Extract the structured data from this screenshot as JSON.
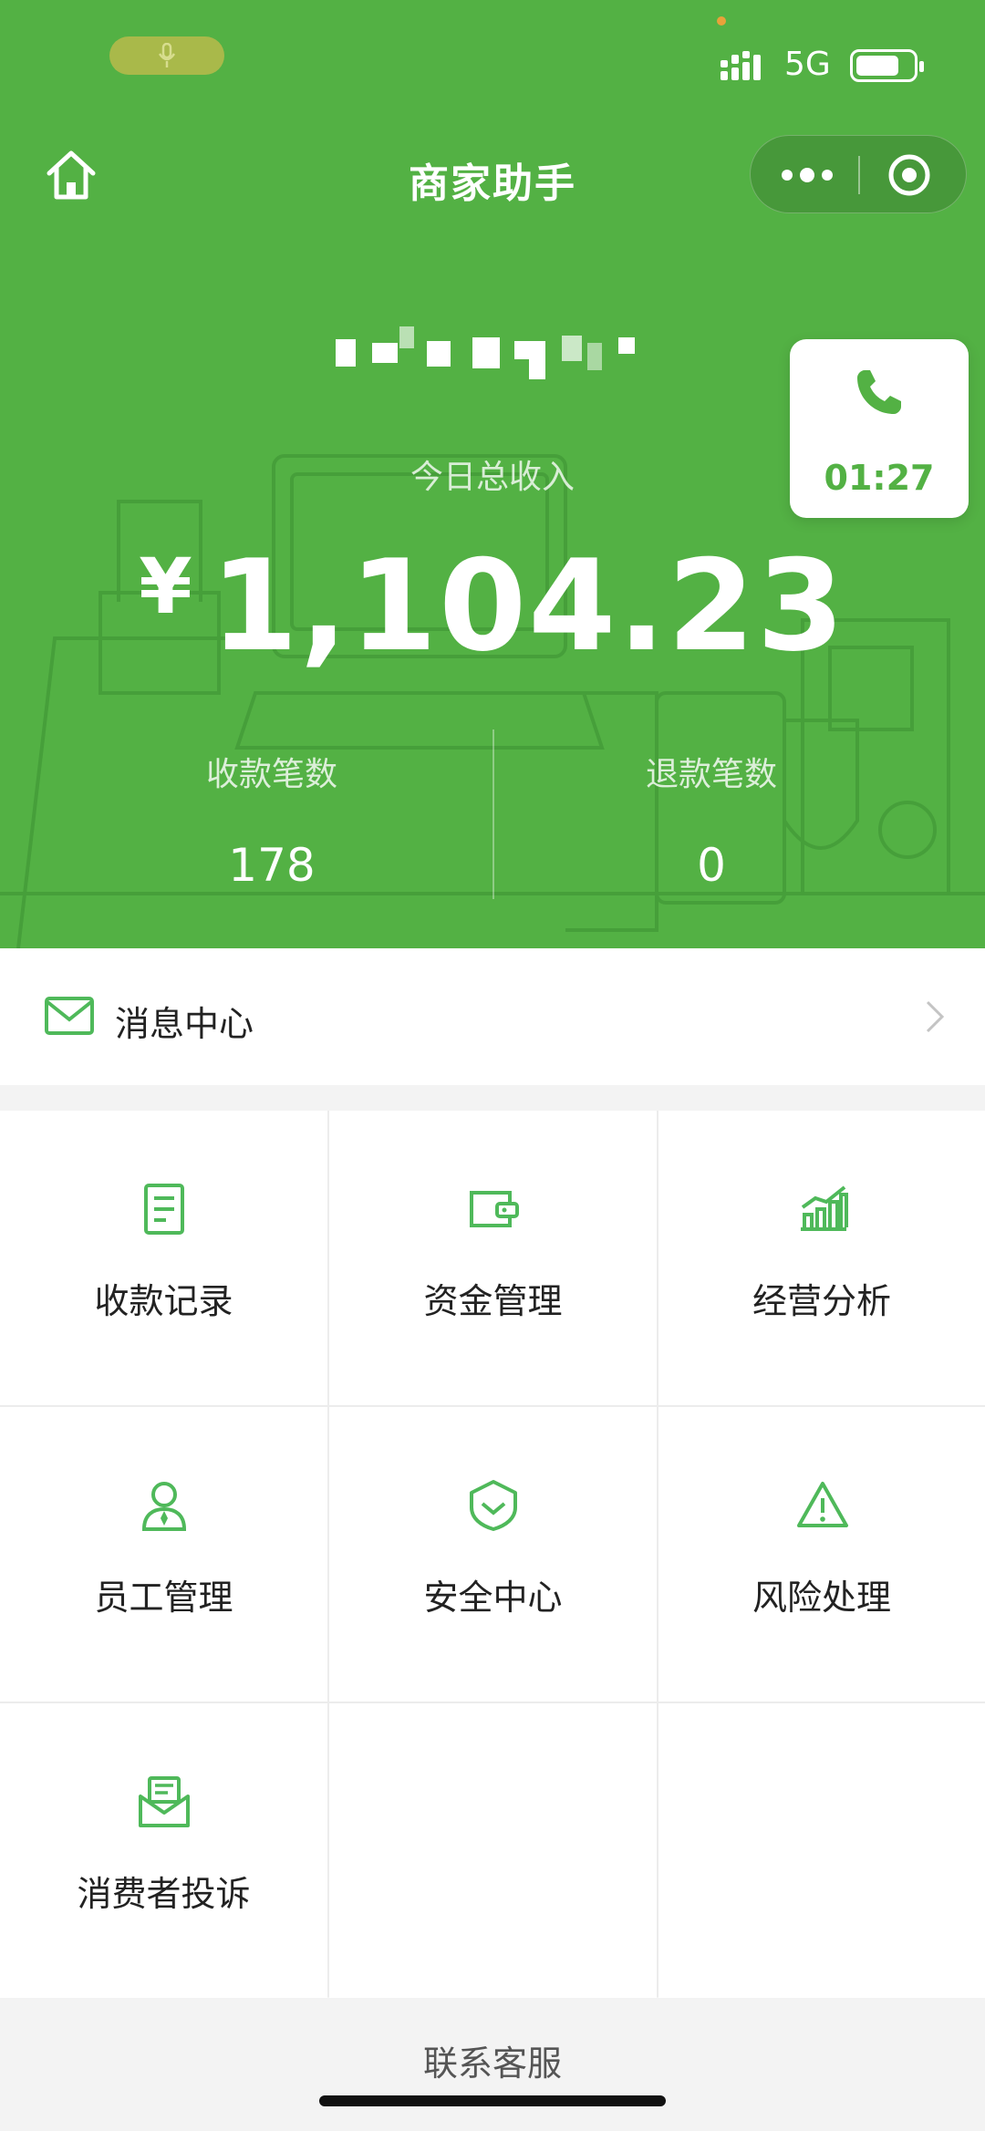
{
  "status_bar": {
    "network": "5G"
  },
  "nav": {
    "title": "商家助手"
  },
  "call": {
    "duration": "01:27"
  },
  "summary": {
    "income_label": "今日总收入",
    "currency": "¥",
    "income_amount": "1,104.23",
    "stats": [
      {
        "label": "收款笔数",
        "value": "178"
      },
      {
        "label": "退款笔数",
        "value": "0"
      }
    ]
  },
  "message_center": {
    "label": "消息中心"
  },
  "menu": [
    {
      "label": "收款记录",
      "icon": "receipt-icon"
    },
    {
      "label": "资金管理",
      "icon": "wallet-icon"
    },
    {
      "label": "经营分析",
      "icon": "chart-icon"
    },
    {
      "label": "员工管理",
      "icon": "staff-icon"
    },
    {
      "label": "安全中心",
      "icon": "shield-icon"
    },
    {
      "label": "风险处理",
      "icon": "warning-icon"
    },
    {
      "label": "消费者投诉",
      "icon": "complaint-icon"
    }
  ],
  "footer": {
    "contact_label": "联系客服"
  },
  "colors": {
    "brand_green": "#53b144",
    "icon_green": "#4fb95a"
  }
}
